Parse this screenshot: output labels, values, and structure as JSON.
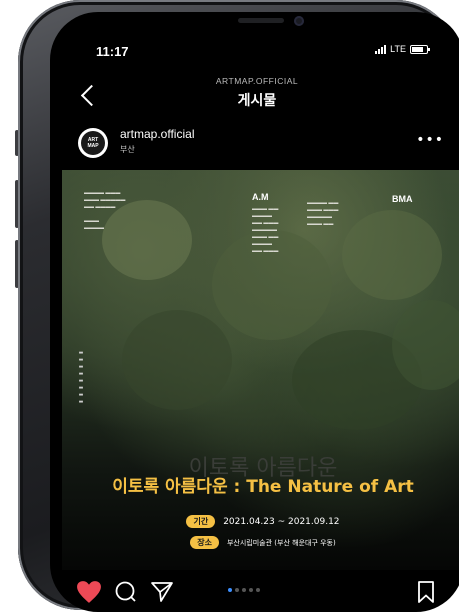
{
  "status_bar": {
    "time": "11:17",
    "network": "LTE"
  },
  "header": {
    "account": "ARTMAP.OFFICIAL",
    "title": "게시물"
  },
  "post_author": {
    "avatar_line1": "ART",
    "avatar_line2": "MAP",
    "username": "artmap.official",
    "location": "부산"
  },
  "post_image": {
    "logo_left": "A.M",
    "logo_right": "BMA",
    "ghost_title": "이토록 아름다운",
    "title": "이토록 아름다운 : The Nature of Art",
    "period_label": "기간",
    "period_value": "2021.04.23 ~ 2021.09.12",
    "venue_label": "장소",
    "venue_value": "부산시립미술관 (부산 해운대구 우동)"
  },
  "colors": {
    "accent": "#f5c044",
    "like": "#ed4956",
    "carousel_active": "#3d8fff"
  },
  "icons": [
    "heart-icon",
    "comment-icon",
    "send-icon",
    "bookmark-icon",
    "back-icon",
    "more-icon"
  ]
}
